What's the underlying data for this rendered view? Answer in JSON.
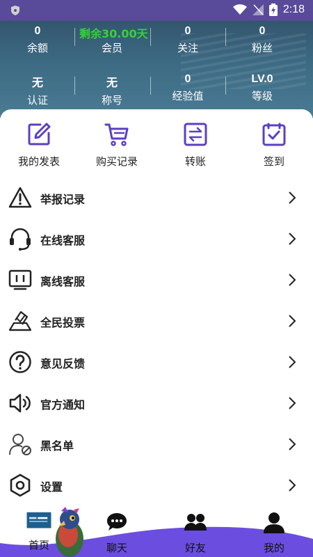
{
  "status": {
    "time": "2:18"
  },
  "header": {
    "vip_text": "剩余30.00天",
    "stats_top": [
      {
        "value": "0",
        "label": "余额"
      },
      {
        "value": "",
        "label": "会员"
      },
      {
        "value": "0",
        "label": "关注"
      },
      {
        "value": "0",
        "label": "粉丝"
      }
    ],
    "stats_bottom": [
      {
        "value": "无",
        "label": "认证"
      },
      {
        "value": "无",
        "label": "称号"
      },
      {
        "value": "0",
        "label": "经验值"
      },
      {
        "value": "LV.0",
        "label": "等级"
      }
    ]
  },
  "quick_actions": [
    {
      "label": "我的发表",
      "icon": "edit-icon"
    },
    {
      "label": "购买记录",
      "icon": "cart-icon"
    },
    {
      "label": "转账",
      "icon": "transfer-icon"
    },
    {
      "label": "签到",
      "icon": "checkin-icon"
    }
  ],
  "menu": [
    {
      "label": "举报记录",
      "icon": "warning-icon"
    },
    {
      "label": "在线客服",
      "icon": "headset-icon"
    },
    {
      "label": "离线客服",
      "icon": "monitor-icon"
    },
    {
      "label": "全民投票",
      "icon": "vote-icon"
    },
    {
      "label": "意见反馈",
      "icon": "question-icon"
    },
    {
      "label": "官方通知",
      "icon": "speaker-icon"
    },
    {
      "label": "黑名单",
      "icon": "blocked-user-icon"
    },
    {
      "label": "设置",
      "icon": "settings-icon"
    }
  ],
  "nav": [
    {
      "label": "首页",
      "icon": "home-thumbnail-icon"
    },
    {
      "label": "聊天",
      "icon": "chat-icon"
    },
    {
      "label": "好友",
      "icon": "friends-icon"
    },
    {
      "label": "我的",
      "icon": "me-icon"
    }
  ],
  "colors": {
    "accent": "#5b3fc4",
    "nav_wave": "#6b4ee0",
    "vip_green": "#35d13a",
    "text": "#222222"
  }
}
